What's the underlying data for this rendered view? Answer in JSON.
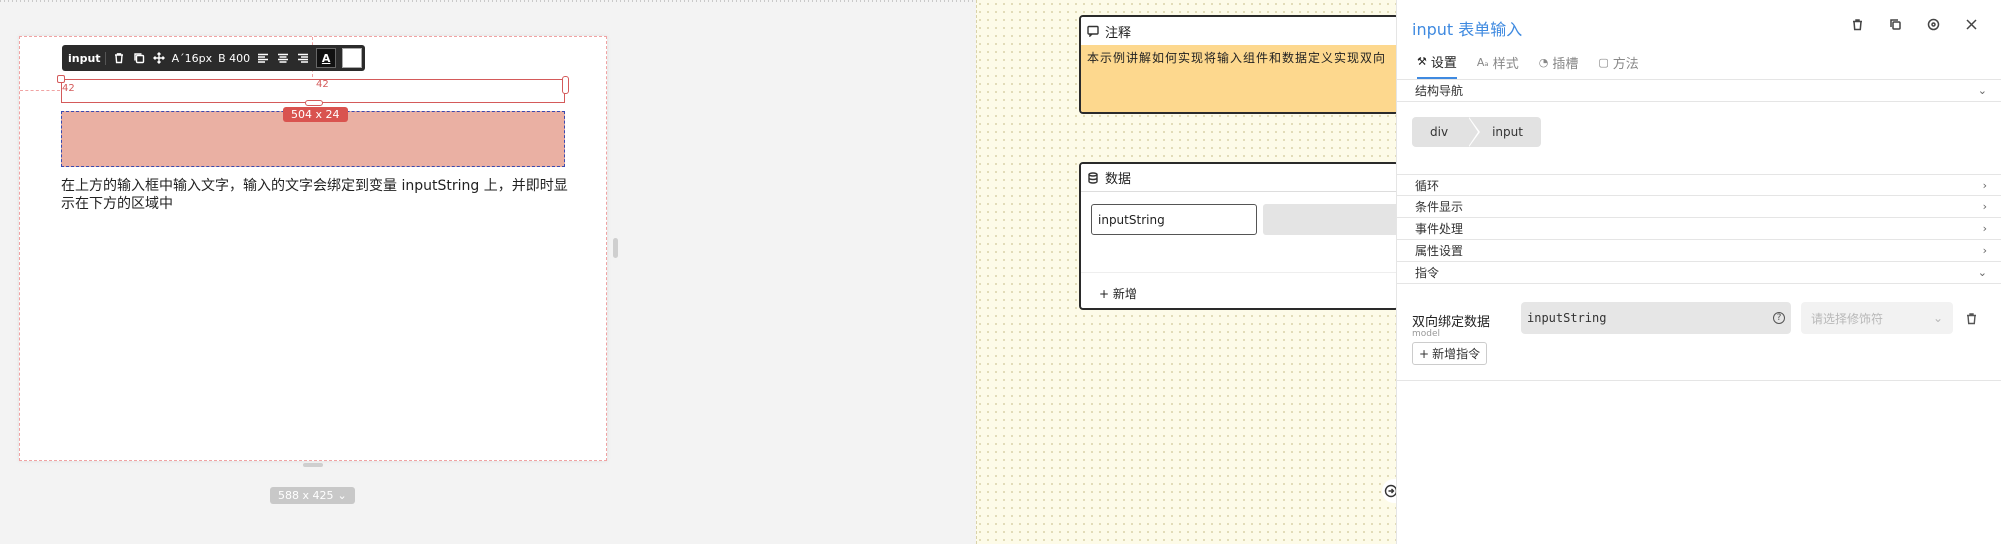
{
  "canvas": {
    "toolbar": {
      "label": "input",
      "font_size": "A´16px",
      "font_weight": "B 400",
      "text_color_glyph": "A"
    },
    "dims": {
      "left": "42",
      "top": "42"
    },
    "size_badge": "504 x 24",
    "description": "在上方的输入框中输入文字，输入的文字会绑定到变量 inputString 上，并即时显示在下方的区域中",
    "canvas_size": "588 x 425",
    "canvas_size_chevron": "⌄"
  },
  "note_card": {
    "title": "注释",
    "body": "本示例讲解如何实现将输入组件和数据定义实现双向"
  },
  "data_card": {
    "title": "数据",
    "input_value": "inputString",
    "add_label": "新增"
  },
  "panel": {
    "title": "input 表单输入",
    "tabs": [
      {
        "glyph": "⚒",
        "label": "设置"
      },
      {
        "glyph": "Aₐ",
        "label": "样式"
      },
      {
        "glyph": "◔",
        "label": "插槽"
      },
      {
        "glyph": "▢",
        "label": "方法"
      }
    ],
    "sections": {
      "structure_nav": "结构导航",
      "loop": "循环",
      "conditional": "条件显示",
      "events": "事件处理",
      "properties": "属性设置",
      "directives": "指令"
    },
    "breadcrumb": [
      "div",
      "input"
    ],
    "directive": {
      "label": "双向绑定数据",
      "sub": "model",
      "value": "inputString",
      "modifier_placeholder": "请选择修饰符",
      "add_label": "新增指令"
    },
    "accent_color": "#3f8ae0"
  }
}
